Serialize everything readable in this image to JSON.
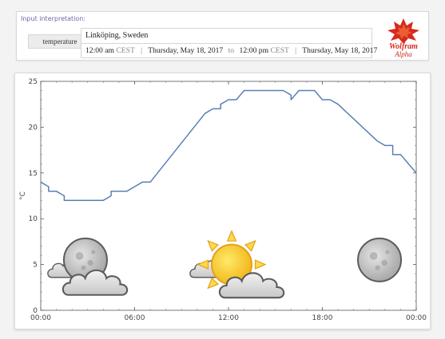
{
  "input": {
    "title": "Input interpretation:",
    "parameter": "temperature",
    "location": "Linköping, Sweden",
    "start_time": "12:00 am",
    "start_tz": "CEST",
    "start_date": "Thursday, May 18, 2017",
    "to": "to",
    "end_time": "12:00 pm",
    "end_tz": "CEST",
    "end_date": "Thursday, May 18, 2017",
    "separator": "|"
  },
  "logo": {
    "line1": "Wolfram",
    "line2": "Alpha",
    "accent": "#d52a1c"
  },
  "chart_data": {
    "type": "line",
    "ylabel": "°C",
    "ylim": [
      0,
      25
    ],
    "yticks": [
      0,
      5,
      10,
      15,
      20,
      25
    ],
    "xlim": [
      0,
      24
    ],
    "xticks": [
      0,
      6,
      12,
      18,
      24
    ],
    "xtick_labels": [
      "00:00",
      "06:00",
      "12:00",
      "18:00",
      "00:00"
    ],
    "x_unit": "hours",
    "color": "#5b7fb6",
    "series": [
      {
        "x": [
          0,
          0.5,
          0.5,
          1,
          1.5,
          1.5,
          2,
          2.5,
          3,
          3.5,
          4,
          4.5,
          4.5,
          5,
          5.5,
          6,
          6.5,
          6.5,
          7,
          10.5,
          11,
          11,
          11.5,
          11.5,
          12,
          12,
          12.5,
          13,
          13.5,
          14,
          14.5,
          15,
          15.5,
          15.5,
          16,
          16,
          16.5,
          17,
          17.5,
          17.5,
          18,
          18.5,
          18.5,
          19,
          21.5,
          22,
          22.5,
          22.5,
          23,
          24
        ],
        "y": [
          14,
          13.5,
          13,
          13,
          12.5,
          12,
          12,
          12,
          12,
          12,
          12,
          12.5,
          13,
          13,
          13,
          13.5,
          14,
          14,
          14,
          21.5,
          22,
          22,
          22,
          22.5,
          23,
          23,
          23,
          24,
          24,
          24,
          24,
          24,
          24,
          24,
          23.5,
          23,
          24,
          24,
          24,
          24,
          23,
          23,
          23,
          22.5,
          18.5,
          18,
          18,
          17,
          17,
          15
        ]
      }
    ],
    "weather_icons": [
      {
        "x": 2.5,
        "type": "night-cloudy"
      },
      {
        "x": 12,
        "type": "partly-cloudy"
      },
      {
        "x": 21.5,
        "type": "clear-night"
      }
    ]
  }
}
